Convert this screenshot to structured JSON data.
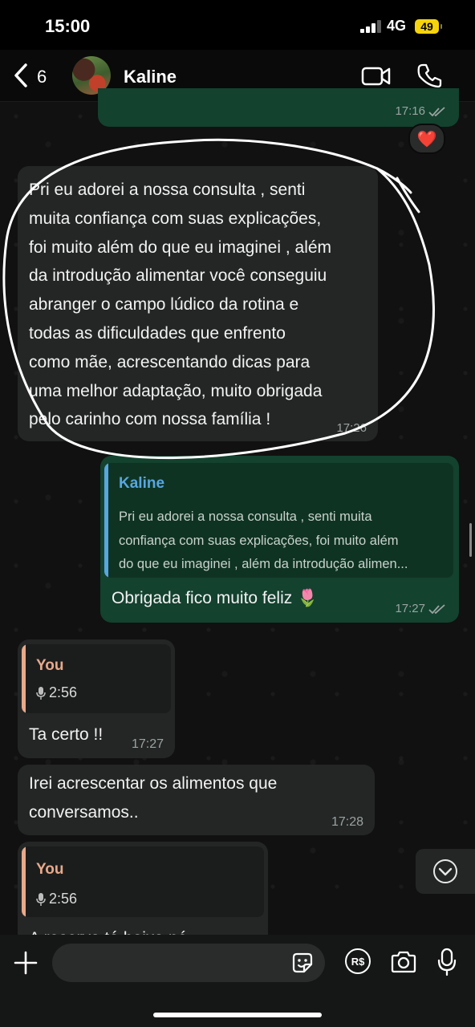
{
  "status_bar": {
    "time": "15:00",
    "network": "4G",
    "battery": "49"
  },
  "header": {
    "back_count": "6",
    "contact_name": "Kaline"
  },
  "colors": {
    "outgoing_bubble": "#13422f",
    "incoming_bubble": "#242626",
    "read_ticks": "#9aa3a0",
    "quote_name_kaline": "#58a6e0",
    "quote_name_you": "#e8a98a",
    "annotation": "#ffffff"
  },
  "messages": [
    {
      "direction": "outgoing",
      "time": "17:16",
      "status": "read",
      "reaction": "❤️"
    },
    {
      "direction": "incoming",
      "time": "17:26",
      "text": "Pri eu adorei a nossa consulta , senti\nmuita confiança com suas explicações,\nfoi muito além do que eu imaginei , além\nda introdução alimentar você conseguiu\nabranger o campo lúdico da rotina e\ntodas as dificuldades que enfrento\ncomo mãe, acrescentando dicas para\numa melhor adaptação, muito obrigada\npelo carinho com nossa família !",
      "annotation": "hand-drawn circle"
    },
    {
      "direction": "outgoing",
      "time": "17:27",
      "status": "read",
      "quote": {
        "name": "Kaline",
        "text": "Pri eu adorei a nossa consulta , senti muita\nconfiança com suas explicações, foi muito além\ndo que eu imaginei , além da introdução alimen..."
      },
      "text": "Obrigada fico muito feliz 🌷"
    },
    {
      "direction": "incoming",
      "time": "17:27",
      "quote": {
        "name": "You",
        "voice_duration": "2:56"
      },
      "text": "Ta certo !!"
    },
    {
      "direction": "incoming",
      "time": "17:28",
      "text": "Irei acrescentar os alimentos que\nconversamos.."
    },
    {
      "direction": "incoming",
      "quote": {
        "name": "You",
        "voice_duration": "2:56"
      },
      "text": "A reserva tá baixa né"
    }
  ],
  "icons": {
    "back": "chevron-left-icon",
    "video": "video-camera-icon",
    "call": "phone-icon",
    "scroll_down": "chevron-down-circle-icon",
    "plus": "plus-icon",
    "sticker": "sticker-icon",
    "pix": "pix-real-icon",
    "camera": "camera-icon",
    "mic": "microphone-icon"
  },
  "composer": {
    "pix_label": "R$",
    "placeholder": ""
  }
}
